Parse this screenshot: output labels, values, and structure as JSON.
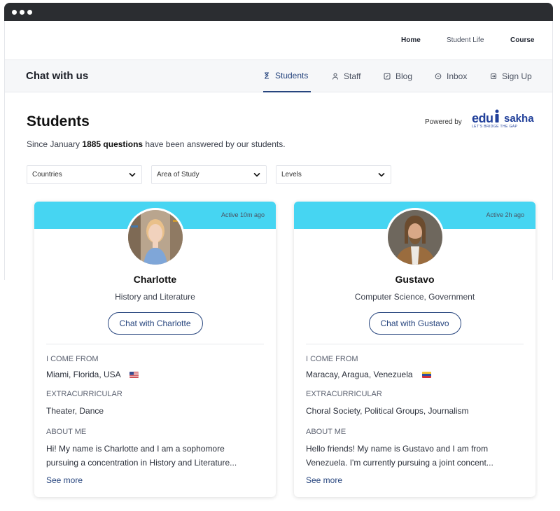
{
  "topnav": {
    "home": "Home",
    "student_life": "Student Life",
    "course": "Course"
  },
  "chatbar": {
    "title": "Chat with us",
    "tabs": [
      {
        "label": "Students",
        "icon": "hourglass-icon"
      },
      {
        "label": "Staff",
        "icon": "person-icon"
      },
      {
        "label": "Blog",
        "icon": "edit-icon"
      },
      {
        "label": "Inbox",
        "icon": "chat-icon"
      },
      {
        "label": "Sign Up",
        "icon": "signin-icon"
      }
    ]
  },
  "page": {
    "title": "Students",
    "subtitle_pre": "Since January ",
    "subtitle_bold": "1885 questions",
    "subtitle_post": " have been answered by our students.",
    "powered_by": "Powered by",
    "logo": {
      "edu": "edu",
      "sakha": "sakha",
      "tagline": "LET'S BRIDGE THE GAP"
    }
  },
  "filters": [
    {
      "label": "Countries"
    },
    {
      "label": "Area of Study"
    },
    {
      "label": "Levels"
    }
  ],
  "cards": [
    {
      "active": "Active 10m ago",
      "name": "Charlotte",
      "study": "History and Literature",
      "button": "Chat with Charlotte",
      "from_label": "I COME FROM",
      "from": "Miami, Florida, USA",
      "flag": "us-flag",
      "extra_label": "EXTRACURRICULAR",
      "extra": "Theater, Dance",
      "about_label": "ABOUT ME",
      "about_line1": "Hi! My name is Charlotte and I am a sophomore",
      "about_line2": "pursuing a concentration in History and Literature...",
      "more": "See more"
    },
    {
      "active": "Active 2h ago",
      "name": "Gustavo",
      "study": "Computer Science, Government",
      "button": "Chat with Gustavo",
      "from_label": "I COME FROM",
      "from": "Maracay, Aragua, Venezuela",
      "flag": "venezuela-flag",
      "extra_label": "EXTRACURRICULAR",
      "extra": "Choral Society, Political Groups, Journalism",
      "about_label": "ABOUT ME",
      "about_line1": "Hello friends! My name is Gustavo and I am from",
      "about_line2": "Venezuela. I'm currently pursuing a joint concent...",
      "more": "See more"
    }
  ],
  "colors": {
    "accent": "#27457e",
    "card_header": "#46d5f2",
    "logo": "#21409a"
  }
}
